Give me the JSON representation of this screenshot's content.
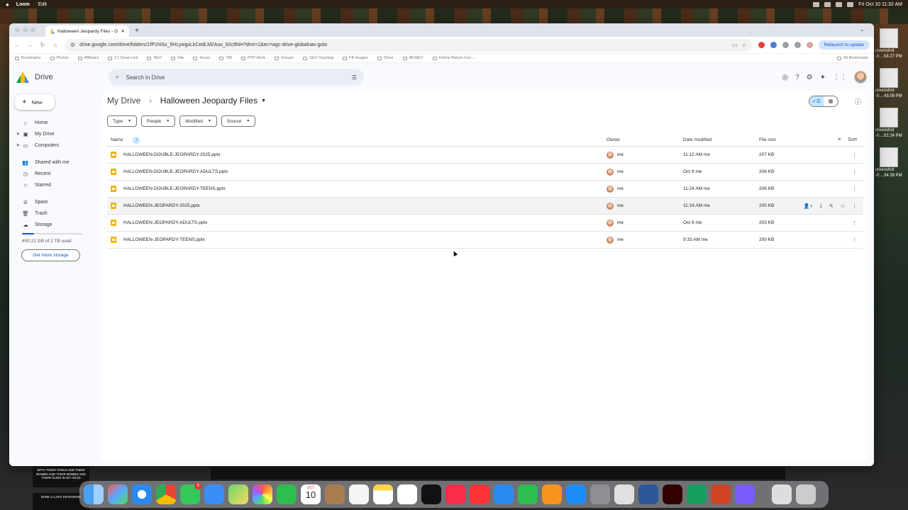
{
  "menubar": {
    "app": "Loom",
    "menu": "Edit",
    "clock": "Fri Oct 10  11:32 AM"
  },
  "browser": {
    "tab_title": "Halloween Jeopardy Files - G",
    "url": "drive.google.com/drive/folders/1fP1NSu_5HLywgvLkCedLM2Aux_92c9NH?dmr=1&ec=wgc-drive-globalnav-goto",
    "relaunch": "Relaunch to update",
    "bookmarks": [
      "Bookmarks",
      "Photos",
      "Affiliates",
      "CJ Deep Link",
      "SEO",
      "Site",
      "Hours",
      "YW",
      "PPP Work",
      "Groups",
      "SEO Tracking",
      "FB Images",
      "Timer",
      "MONEY",
      "Online Return Cen..."
    ],
    "all_bookmarks": "All Bookmarks"
  },
  "drive": {
    "logo": "Drive",
    "search_placeholder": "Search in Drive",
    "new_label": "New",
    "nav": [
      {
        "label": "Home",
        "icon": "home-icon"
      },
      {
        "label": "My Drive",
        "icon": "my-drive-icon"
      },
      {
        "label": "Computers",
        "icon": "computers-icon"
      },
      {
        "label": "Shared with me",
        "icon": "shared-icon"
      },
      {
        "label": "Recent",
        "icon": "recent-icon"
      },
      {
        "label": "Starred",
        "icon": "star-icon"
      },
      {
        "label": "Spam",
        "icon": "spam-icon"
      },
      {
        "label": "Trash",
        "icon": "trash-icon"
      },
      {
        "label": "Storage",
        "icon": "cloud-icon"
      }
    ],
    "storage_used": 0.2,
    "storage_text": "400.22 GB of 2 TB used",
    "get_more": "Get more storage",
    "breadcrumb": {
      "root": "My Drive",
      "current": "Halloween Jeopardy Files"
    },
    "filters": [
      "Type",
      "People",
      "Modified",
      "Source"
    ],
    "columns": {
      "name": "Name",
      "owner": "Owner",
      "date": "Date modified",
      "size": "File size",
      "sort": "Sort"
    },
    "files": [
      {
        "name": "HALLOWEEN-DOUBLE-JEOPARDY-2025.pptx",
        "owner": "me",
        "date": "11:12 AM me",
        "size": "207 KB"
      },
      {
        "name": "HALLOWEEN-DOUBLE-JEOPARDY-ADULTS.pptx",
        "owner": "me",
        "date": "Oct 9 me",
        "size": "206 KB"
      },
      {
        "name": "HALLOWEEN-DOUBLE-JEOPARDY-TEENS.pptx",
        "owner": "me",
        "date": "11:24 AM me",
        "size": "206 KB"
      },
      {
        "name": "HALLOWEEN-JEOPARDY-2025.pptx",
        "owner": "me",
        "date": "11:19 AM me",
        "size": "200 KB"
      },
      {
        "name": "HALLOWEEN-JEOPARDY-ADULTS.pptx",
        "owner": "me",
        "date": "Oct 9 me",
        "size": "203 KB"
      },
      {
        "name": "HALLOWEEN-JEOPARDY-TEENS.pptx",
        "owner": "me",
        "date": "9:33 AM me",
        "size": "200 KB"
      }
    ]
  },
  "desktop_files": [
    {
      "label": "creenshot",
      "sub": "-0....58.27 PM"
    },
    {
      "label": "creenshot",
      "sub": "-0....43.09 PM"
    },
    {
      "label": "creenshot",
      "sub": "-0....02.24 PM"
    },
    {
      "label": "creenshot",
      "sub": "-0....34.39 PM"
    }
  ],
  "thumbs": [
    "WITH THEIR TANKS AND THEIR BOMBS AND THEIR BOMBS AND THEIR GUNS IN MY HEAD",
    "DARE U LADY FEATURING"
  ],
  "dock_badges": {
    "messages": "9",
    "calendar_month": "OCT",
    "calendar_day": "10"
  },
  "colors": {
    "accent": "#0b57d0",
    "selected": "#c2e7ff",
    "ppt": "#f5b400"
  }
}
